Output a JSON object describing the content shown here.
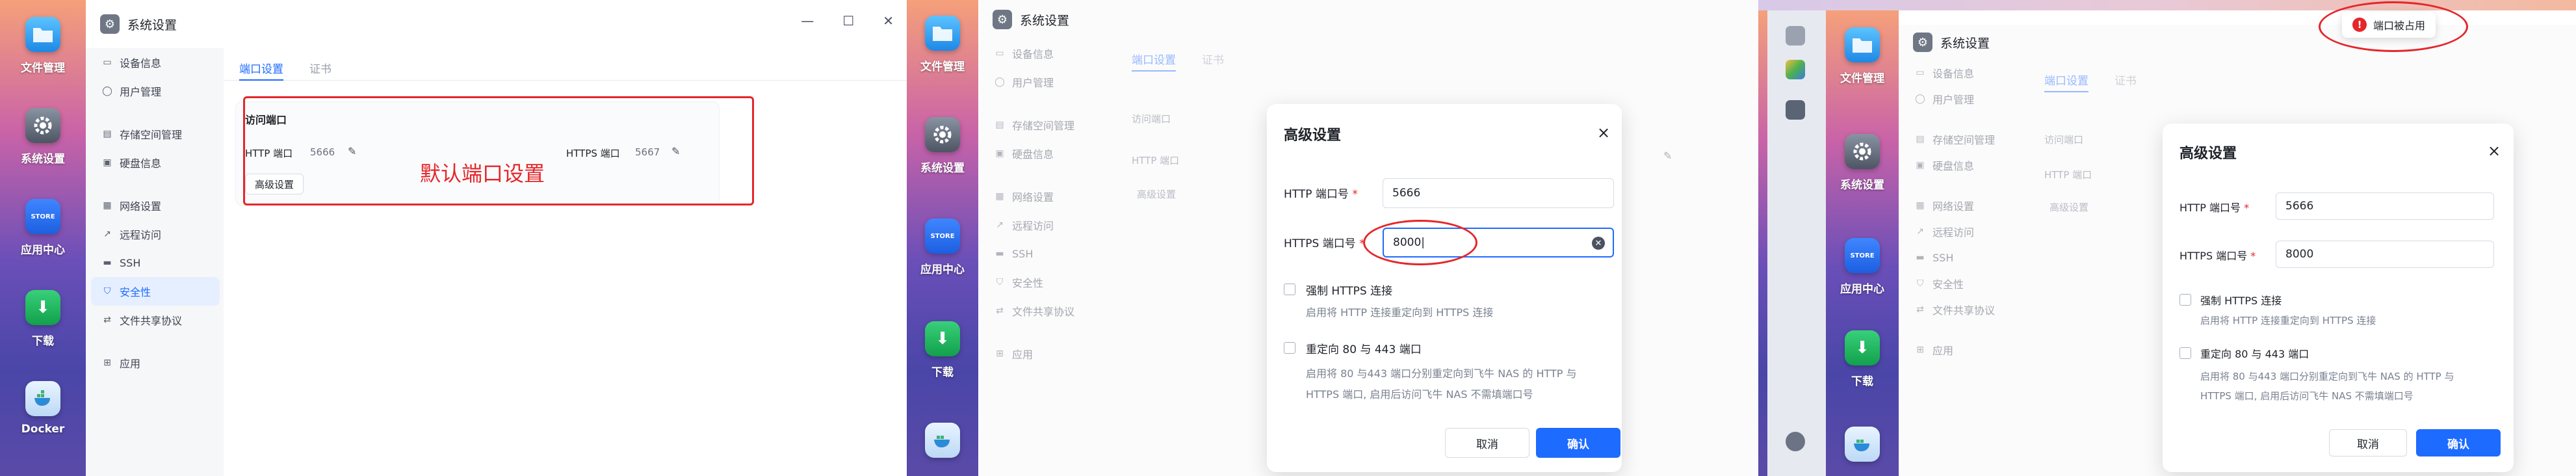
{
  "dock": [
    {
      "label": "文件管理",
      "icon": "folder-icon"
    },
    {
      "label": "系统设置",
      "icon": "gear-icon"
    },
    {
      "label": "应用中心",
      "icon": "store-icon"
    },
    {
      "label": "下载",
      "icon": "download-icon"
    },
    {
      "label": "Docker",
      "icon": "docker-icon"
    }
  ],
  "store_badge": "STORE",
  "window": {
    "title": "系统设置",
    "min": "—",
    "max": "☐",
    "close": "✕"
  },
  "sidebar": [
    {
      "label": "设备信息",
      "icon": "device-info-icon"
    },
    {
      "label": "用户管理",
      "icon": "user-icon"
    },
    {
      "label": "存储空间管理",
      "icon": "storage-icon"
    },
    {
      "label": "硬盘信息",
      "icon": "disk-icon"
    },
    {
      "label": "网络设置",
      "icon": "network-icon"
    },
    {
      "label": "远程访问",
      "icon": "remote-icon"
    },
    {
      "label": "SSH",
      "icon": "terminal-icon"
    },
    {
      "label": "安全性",
      "icon": "shield-icon"
    },
    {
      "label": "文件共享协议",
      "icon": "share-icon"
    },
    {
      "label": "应用",
      "icon": "apps-icon"
    }
  ],
  "tabs": [
    "端口设置",
    "证书"
  ],
  "card": {
    "title": "访问端口",
    "http_label": "HTTP 端口",
    "http_value": "5666",
    "https_label": "HTTPS 端口",
    "https_value": "5667",
    "advanced_button": "高级设置"
  },
  "annotation": "默认端口设置",
  "modal": {
    "title": "高级设置",
    "close": "×",
    "http_label": "HTTP 端口号",
    "https_label": "HTTPS 端口号",
    "required_mark": "*",
    "http_value": "5666",
    "https_value": "8000",
    "force_https_label": "强制 HTTPS 连接",
    "force_https_desc": "启用将 HTTP 连接重定向到 HTTPS 连接",
    "redirect_label": "重定向 80 与 443 端口",
    "redirect_desc_1": "启用将 80 与443 端口分别重定向到飞牛 NAS 的 HTTP 与",
    "redirect_desc_2": "HTTPS 端口, 启用后访问飞牛 NAS 不需填端口号",
    "cancel": "取消",
    "confirm": "确认"
  },
  "toast": {
    "icon": "!",
    "text": "端口被占用"
  },
  "colors": {
    "accent": "#1e6bff",
    "annotation_red": "#e5262a"
  }
}
